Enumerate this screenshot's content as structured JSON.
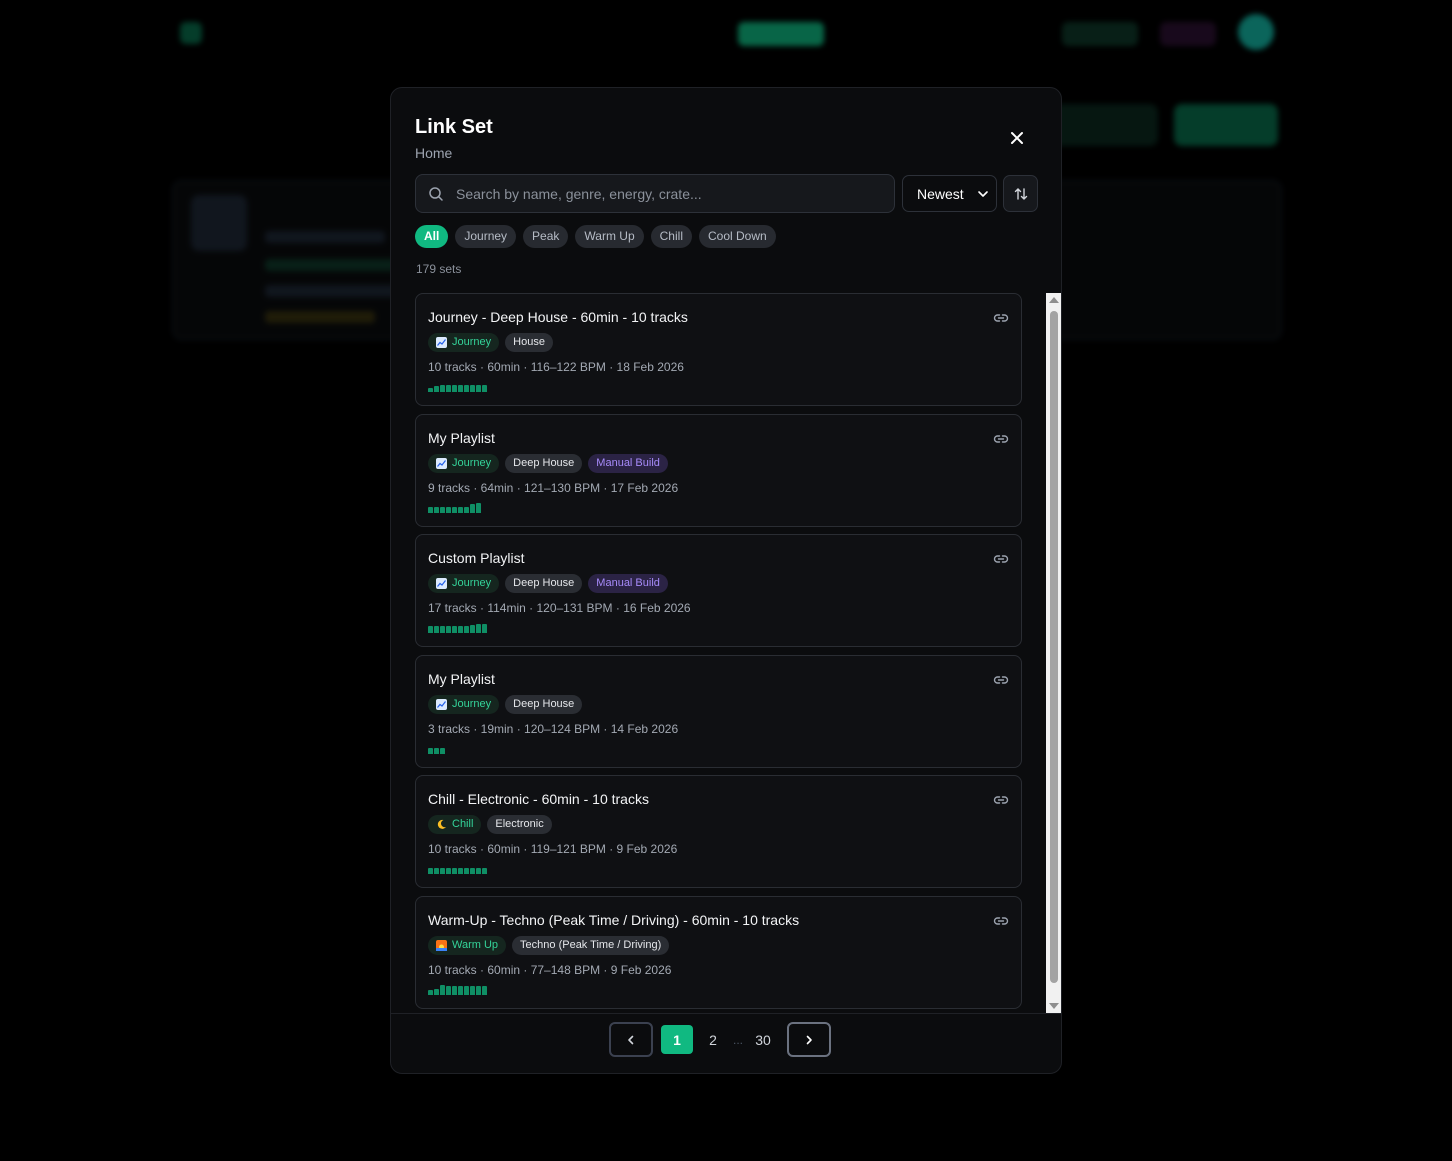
{
  "modal": {
    "title": "Link Set",
    "subtitle": "Home",
    "search_placeholder": "Search by name, genre, energy, crate...",
    "sort_value": "Newest",
    "filters": [
      "All",
      "Journey",
      "Peak",
      "Warm Up",
      "Chill",
      "Cool Down"
    ],
    "active_filter": "All",
    "count_label": "179 sets",
    "sets": [
      {
        "title": "Journey - Deep House - 60min - 10 tracks",
        "type_tag": "Journey",
        "type_icon": "chart-icon",
        "tags": [
          "House"
        ],
        "meta": "10 tracks · 60min · 116–122 BPM · 18 Feb 2026",
        "energy": [
          0.4,
          0.6,
          0.7,
          0.7,
          0.7,
          0.7,
          0.7,
          0.7,
          0.7,
          0.7
        ]
      },
      {
        "title": "My Playlist",
        "type_tag": "Journey",
        "type_icon": "chart-icon",
        "tags": [
          "Deep House"
        ],
        "manual_tag": "Manual Build",
        "meta": "9 tracks · 64min · 121–130 BPM · 17 Feb 2026",
        "energy": [
          0.6,
          0.6,
          0.6,
          0.6,
          0.6,
          0.6,
          0.6,
          0.85,
          0.95
        ]
      },
      {
        "title": "Custom Playlist",
        "type_tag": "Journey",
        "type_icon": "chart-icon",
        "tags": [
          "Deep House"
        ],
        "manual_tag": "Manual Build",
        "meta": "17 tracks · 114min · 120–131 BPM · 16 Feb 2026",
        "energy": [
          0.65,
          0.65,
          0.65,
          0.65,
          0.65,
          0.65,
          0.65,
          0.75,
          0.85,
          0.85
        ]
      },
      {
        "title": "My Playlist",
        "type_tag": "Journey",
        "type_icon": "chart-icon",
        "tags": [
          "Deep House"
        ],
        "meta": "3 tracks · 19min · 120–124 BPM · 14 Feb 2026",
        "energy": [
          0.6,
          0.6,
          0.6
        ]
      },
      {
        "title": "Chill - Electronic - 60min - 10 tracks",
        "type_tag": "Chill",
        "type_icon": "moon-icon",
        "tags": [
          "Electronic"
        ],
        "meta": "10 tracks · 60min · 119–121 BPM · 9 Feb 2026",
        "energy": [
          0.6,
          0.6,
          0.6,
          0.6,
          0.6,
          0.6,
          0.6,
          0.6,
          0.6,
          0.6
        ]
      },
      {
        "title": "Warm-Up - Techno (Peak Time / Driving) - 60min - 10 tracks",
        "type_tag": "Warm Up",
        "type_icon": "sunrise-icon",
        "tags": [
          "Techno (Peak Time / Driving)"
        ],
        "meta": "10 tracks · 60min · 77–148 BPM · 9 Feb 2026",
        "energy": [
          0.45,
          0.6,
          0.95,
          0.9,
          0.9,
          0.9,
          0.9,
          0.9,
          0.9,
          0.9
        ]
      }
    ],
    "pagination": {
      "pages": [
        "1",
        "2",
        "30"
      ],
      "ellipsis": "...",
      "current": "1"
    }
  },
  "colors": {
    "accent": "#10b981",
    "manual": "#a78bfa",
    "panel": "#0b0c0e"
  }
}
